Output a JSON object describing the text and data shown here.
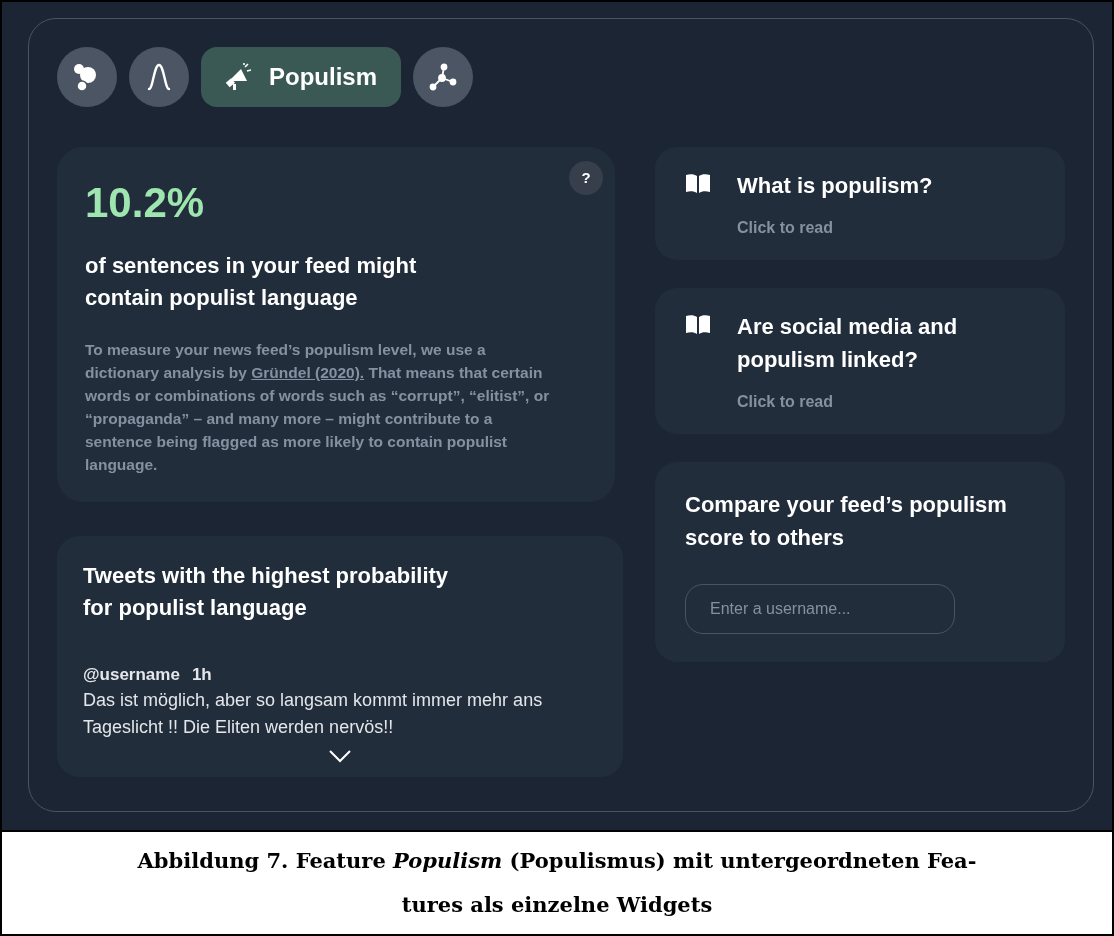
{
  "tabs": [
    {
      "selected": false
    },
    {
      "selected": false
    },
    {
      "label": "Populism",
      "selected": true
    },
    {
      "selected": false
    }
  ],
  "score_card": {
    "value": "10.2%",
    "help": "?",
    "headline": "of sentences in your feed might contain populist language",
    "description_before": "To measure your news feed’s populism level, we use a dictionary analysis by",
    "link": "Gründel (2020).",
    "description_after": "That means that certain words or combinations of words such as “corrupt”, “elitist”, or “propaganda” – and many more – might contribute to a sentence being flagged as more likely to contain populist language."
  },
  "tweets_card": {
    "title": "Tweets with the highest probability for populist language",
    "tweets": [
      {
        "username": "@username",
        "time": "1h",
        "text": "Das ist möglich, aber so langsam kommt immer mehr ans Tageslicht !! Die Eliten werden nervös!!"
      }
    ]
  },
  "read_cards": [
    {
      "title": "What is populism?",
      "action": "Click to read"
    },
    {
      "title": "Are social media and populism linked?",
      "action": "Click to read"
    }
  ],
  "compare_card": {
    "title": "Compare your feed’s populism score to others",
    "placeholder": "Enter a username..."
  },
  "caption": [
    "Abbildung 7. Feature *Populism* (Populismus) mit untergeordneten Fea-",
    "tures als einzelne Widgets"
  ]
}
